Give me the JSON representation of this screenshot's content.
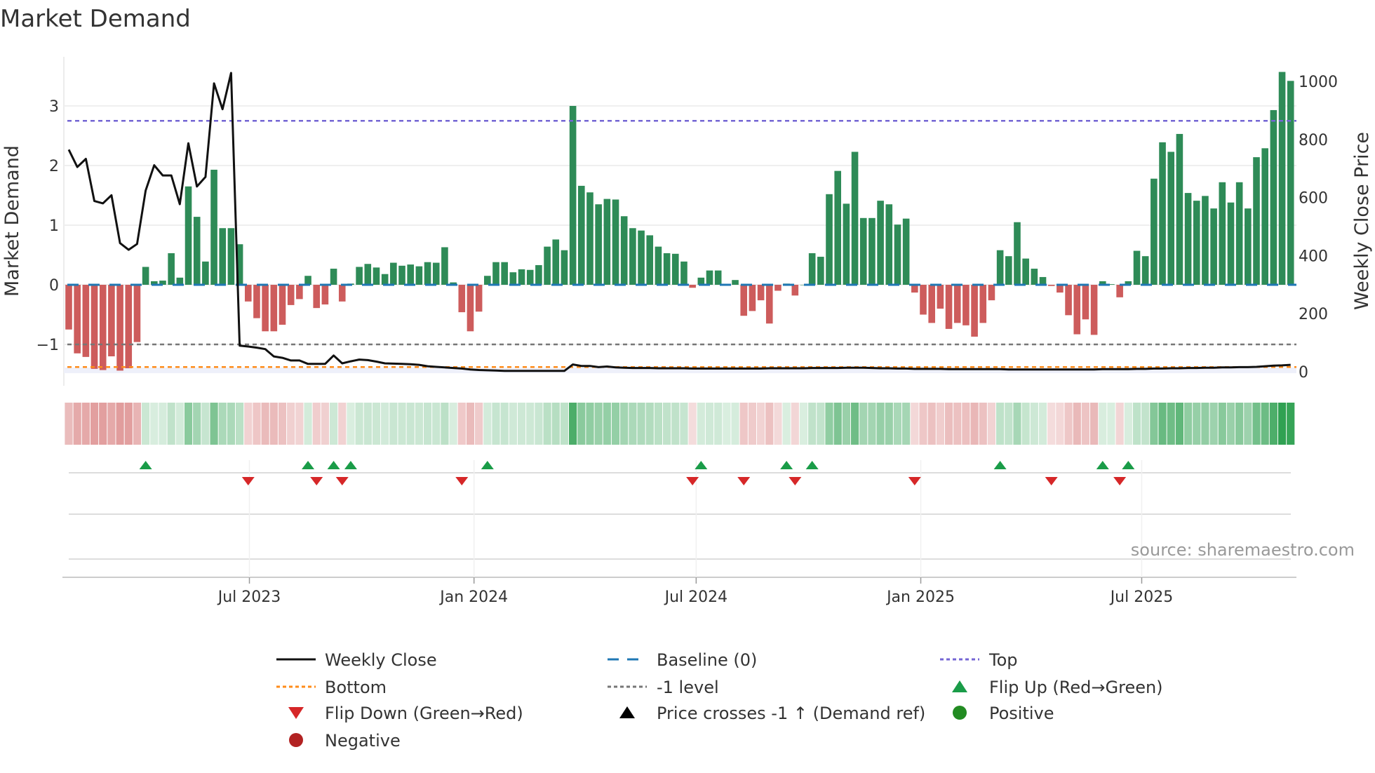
{
  "chart_data": {
    "type": "bar",
    "title": "Market Demand",
    "ylabel": "Market Demand",
    "y2label": "Weekly Close Price",
    "ylim": [
      -1.69,
      3.82
    ],
    "y2lim": [
      -48,
      1085
    ],
    "x_start": "2023-02-03",
    "x_step_days": 7,
    "y_ticks": [
      {
        "v": 3,
        "label": "3"
      },
      {
        "v": 2,
        "label": "2"
      },
      {
        "v": 1,
        "label": "1"
      },
      {
        "v": 0,
        "label": "0"
      },
      {
        "v": -1,
        "label": "−1"
      }
    ],
    "y2_ticks": [
      {
        "v": 0,
        "label": "0"
      },
      {
        "v": 200,
        "label": "200"
      },
      {
        "v": 400,
        "label": "400"
      },
      {
        "v": 600,
        "label": "600"
      },
      {
        "v": 800,
        "label": "800"
      },
      {
        "v": 1000,
        "label": "1000"
      }
    ],
    "x_ticks": [
      {
        "label": "Jul 2023",
        "date": "2023-07-01"
      },
      {
        "label": "Jan 2024",
        "date": "2024-01-01"
      },
      {
        "label": "Jul 2024",
        "date": "2024-07-01"
      },
      {
        "label": "Jan 2025",
        "date": "2025-01-01"
      },
      {
        "label": "Jul 2025",
        "date": "2025-07-01"
      }
    ],
    "levels": {
      "baseline": 0,
      "top": 2.75,
      "minus_one": -1,
      "bottom": -1.38
    },
    "demand": [
      -0.75,
      -1.15,
      -1.21,
      -1.41,
      -1.43,
      -1.2,
      -1.44,
      -1.4,
      -0.96,
      0.3,
      0.06,
      0.07,
      0.53,
      0.12,
      1.65,
      1.14,
      0.39,
      1.93,
      0.95,
      0.95,
      0.68,
      -0.28,
      -0.56,
      -0.78,
      -0.78,
      -0.67,
      -0.34,
      -0.24,
      0.15,
      -0.39,
      -0.33,
      0.27,
      -0.28,
      0.02,
      0.3,
      0.35,
      0.29,
      0.18,
      0.37,
      0.32,
      0.34,
      0.31,
      0.38,
      0.37,
      0.63,
      0.04,
      -0.46,
      -0.78,
      -0.45,
      0.15,
      0.38,
      0.38,
      0.21,
      0.26,
      0.25,
      0.33,
      0.64,
      0.76,
      0.58,
      3.0,
      1.66,
      1.55,
      1.35,
      1.44,
      1.43,
      1.15,
      0.95,
      0.91,
      0.83,
      0.64,
      0.53,
      0.52,
      0.39,
      -0.05,
      0.12,
      0.24,
      0.24,
      0.01,
      0.08,
      -0.52,
      -0.44,
      -0.26,
      -0.65,
      -0.1,
      0.02,
      -0.18,
      0,
      0.53,
      0.47,
      1.52,
      1.91,
      1.36,
      2.23,
      1.12,
      1.12,
      1.41,
      1.35,
      1.01,
      1.11,
      -0.13,
      -0.5,
      -0.64,
      -0.4,
      -0.74,
      -0.64,
      -0.68,
      -0.87,
      -0.64,
      -0.26,
      0.58,
      0.48,
      1.05,
      0.44,
      0.27,
      0.13,
      -0.02,
      -0.13,
      -0.51,
      -0.83,
      -0.58,
      -0.84,
      0.06,
      0.01,
      -0.21,
      0.06,
      0.57,
      0.48,
      1.78,
      2.39,
      2.23,
      2.53,
      1.54,
      1.41,
      1.49,
      1.28,
      1.72,
      1.38,
      1.72,
      1.28,
      2.14,
      2.29,
      2.93,
      3.57,
      3.42
    ],
    "weekly_close": [
      765,
      705,
      733,
      588,
      580,
      608,
      443,
      420,
      440,
      624,
      711,
      676,
      676,
      577,
      787,
      638,
      671,
      993,
      904,
      1029,
      90,
      87,
      83,
      78,
      53,
      48,
      39,
      39,
      27,
      27,
      27,
      56,
      29,
      36,
      42,
      40,
      35,
      29,
      28,
      27,
      26,
      24,
      19,
      17,
      15,
      13,
      11,
      8,
      6,
      5,
      4,
      3,
      3,
      3,
      3,
      3,
      3,
      3,
      3,
      25,
      20,
      20,
      16,
      18,
      15,
      14,
      13,
      13,
      13,
      12,
      12,
      12,
      12,
      11,
      11,
      11,
      11,
      11,
      11,
      11,
      11,
      11,
      12,
      12,
      12,
      12,
      12,
      13,
      13,
      13,
      13,
      14,
      14,
      14,
      13,
      12,
      12,
      11,
      11,
      10,
      10,
      10,
      10,
      9,
      9,
      9,
      9,
      9,
      9,
      9,
      8,
      8,
      8,
      8,
      8,
      8,
      8,
      8,
      8,
      8,
      8,
      9,
      9,
      9,
      9,
      10,
      10,
      11,
      11,
      12,
      12,
      13,
      13,
      14,
      14,
      15,
      15,
      16,
      16,
      17,
      19,
      21,
      22,
      24
    ],
    "flip_up_dates": [
      "2023-04-07",
      "2023-08-18",
      "2023-09-08",
      "2023-09-22",
      "2024-01-12",
      "2024-07-05",
      "2024-09-13",
      "2024-10-04",
      "2025-03-07",
      "2025-05-30",
      "2025-06-20"
    ],
    "flip_down_dates": [
      "2023-06-30",
      "2023-08-25",
      "2023-09-15",
      "2023-12-22",
      "2024-06-28",
      "2024-08-09",
      "2024-09-20",
      "2024-12-27",
      "2025-04-18",
      "2025-06-13"
    ],
    "legend_position": "bottom",
    "legend": [
      {
        "label": "Weekly Close",
        "symbol": "line-solid",
        "color": "#111111"
      },
      {
        "label": "Baseline (0)",
        "symbol": "line-dashed",
        "color": "#1f77b4"
      },
      {
        "label": "Top",
        "symbol": "line-dotted",
        "color": "#7466d4"
      },
      {
        "label": "Bottom",
        "symbol": "line-dotted",
        "color": "#ff8c1a"
      },
      {
        "label": "-1 level",
        "symbol": "line-dotted",
        "color": "#777777"
      },
      {
        "label": "Flip Up (Red→Green)",
        "symbol": "triangle-up",
        "color": "#1a9c48"
      },
      {
        "label": "Flip Down (Green→Red)",
        "symbol": "triangle-down",
        "color": "#d62728"
      },
      {
        "label": "Price crosses -1 ↑ (Demand ref)",
        "symbol": "triangle-up",
        "color": "#000000"
      },
      {
        "label": "Positive",
        "symbol": "circle",
        "color": "#228b22"
      },
      {
        "label": "Negative",
        "symbol": "circle",
        "color": "#b22222"
      }
    ],
    "source": "source: sharemaestro.com",
    "colors": {
      "positive_bar": "#2e8b57",
      "negative_bar": "#cd5c5c",
      "price_line": "#111111"
    }
  }
}
